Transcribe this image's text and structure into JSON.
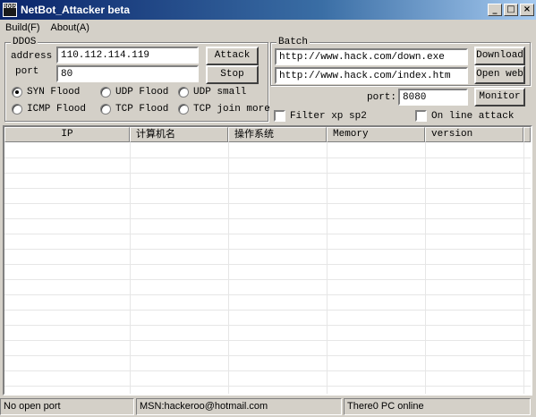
{
  "window": {
    "title": "NetBot_Attacker beta",
    "icon_text": "DDOS"
  },
  "menu": {
    "build": "Build(F)",
    "about": "About(A)"
  },
  "ddos": {
    "group_label": "DDOS",
    "address_label": "address",
    "address_value": "110.112.114.119",
    "port_label": "port",
    "port_value": "80",
    "attack_label": "Attack",
    "stop_label": "Stop",
    "modes": [
      {
        "label": "SYN Flood",
        "checked": true
      },
      {
        "label": "UDP Flood",
        "checked": false
      },
      {
        "label": "UDP small",
        "checked": false
      },
      {
        "label": "ICMP Flood",
        "checked": false
      },
      {
        "label": "TCP Flood",
        "checked": false
      },
      {
        "label": "TCP join more",
        "checked": false
      }
    ]
  },
  "batch": {
    "group_label": "Batch",
    "url1": "http://www.hack.com/down.exe",
    "url2": "http://www.hack.com/index.htm",
    "download_label": "Download",
    "openweb_label": "Open web"
  },
  "monitor": {
    "port_label": "port:",
    "port_value": "8080",
    "monitor_label": "Monitor",
    "filter_label": "Filter xp sp2",
    "online_label": "On line attack"
  },
  "table": {
    "columns": [
      "IP",
      "计算机名",
      "操作系统",
      "Memory",
      "version"
    ],
    "rows": []
  },
  "status": {
    "pane1": "No open port",
    "pane2": "MSN:hackeroo@hotmail.com",
    "pane3": "There0 PC online"
  }
}
